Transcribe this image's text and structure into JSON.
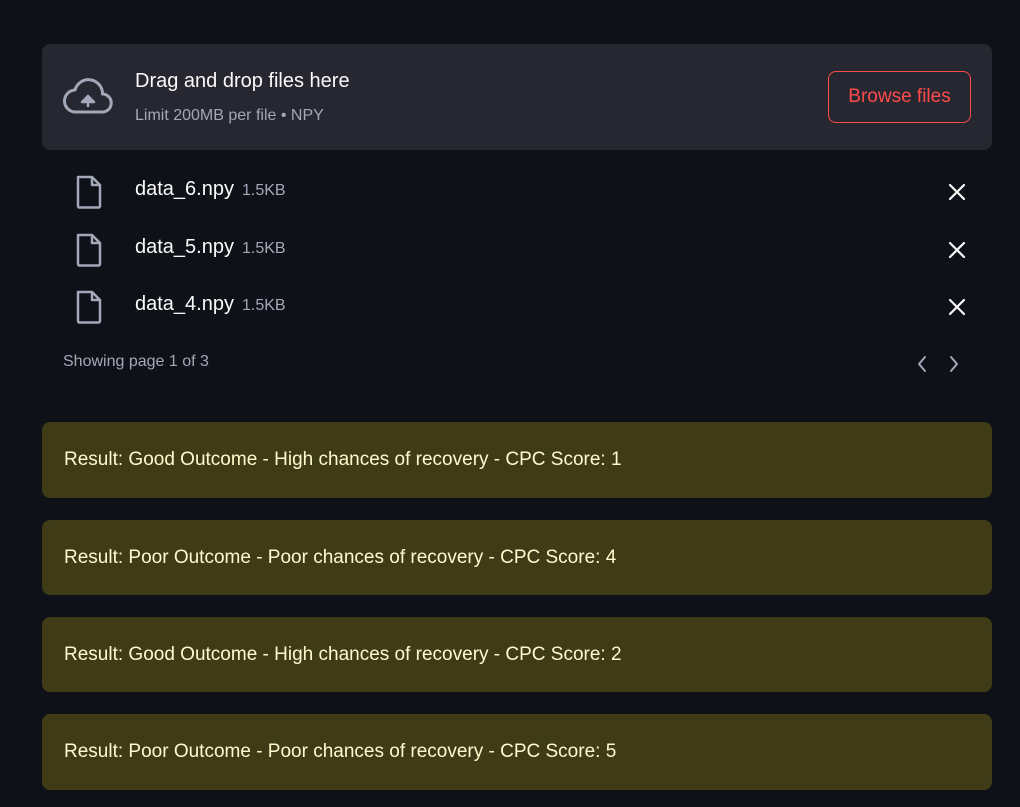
{
  "uploader": {
    "title": "Drag and drop files here",
    "subtitle": "Limit 200MB per file • NPY",
    "browse_label": "Browse files",
    "icon": "cloud-upload-icon"
  },
  "files": [
    {
      "name": "data_6.npy",
      "size": "1.5KB"
    },
    {
      "name": "data_5.npy",
      "size": "1.5KB"
    },
    {
      "name": "data_4.npy",
      "size": "1.5KB"
    }
  ],
  "pagination": {
    "text": "Showing page 1 of 3",
    "current_page": 1,
    "total_pages": 3
  },
  "results": [
    "Result: Good Outcome - High chances of recovery - CPC Score: 1",
    "Result: Poor Outcome - Poor chances of recovery - CPC Score: 4",
    "Result: Good Outcome - High chances of recovery - CPC Score: 2",
    "Result: Poor Outcome - Poor chances of recovery - CPC Score: 5"
  ],
  "colors": {
    "background": "#0e1117",
    "dropzone": "#262730",
    "accent": "#ff4b4b",
    "result_bg": "#3e3b16",
    "result_text": "#fffacd",
    "muted_text": "#a3a8b8"
  }
}
